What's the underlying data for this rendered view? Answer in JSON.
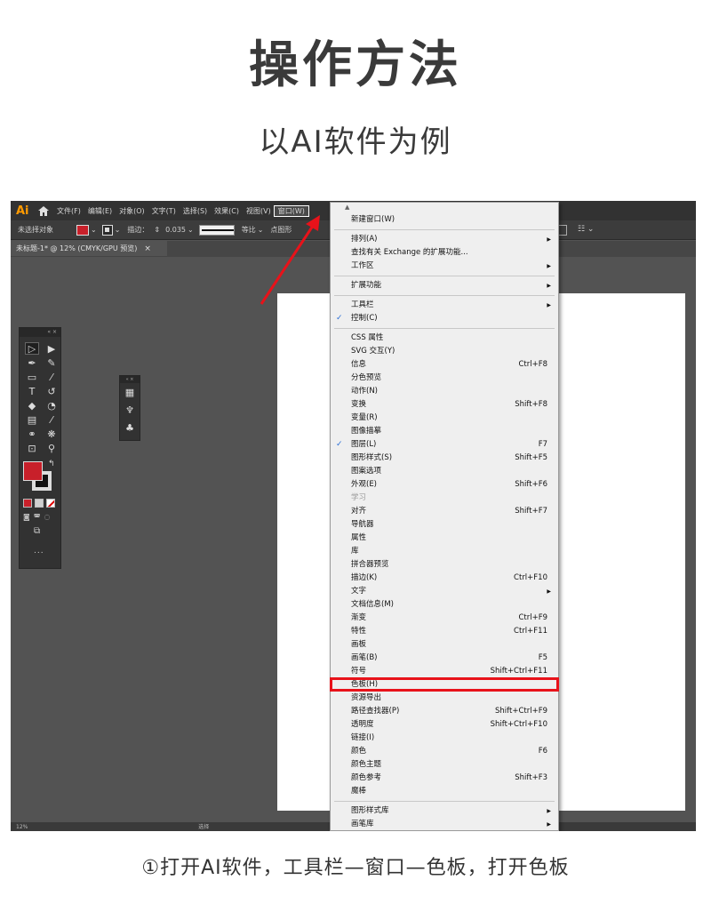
{
  "heading": "操作方法",
  "subheading": "以AI软件为例",
  "caption": "①打开AI软件，工具栏—窗口—色板，打开色板",
  "menubar": {
    "logo": "Ai",
    "items": [
      "文件(F)",
      "编辑(E)",
      "对象(O)",
      "文字(T)",
      "选择(S)",
      "效果(C)",
      "视图(V)",
      "窗口(W)"
    ]
  },
  "controlbar": {
    "selection": "未选择对象",
    "stroke_label": "描边：",
    "stroke_value": "0.035",
    "uniform": "等比",
    "brush": "点图形"
  },
  "document_tab": {
    "title": "未标题-1* @ 12% (CMYK/GPU 预览)",
    "close": "×"
  },
  "statusbar": {
    "zoom": "12%",
    "tool": "选择"
  },
  "tools_panel": {
    "more": "..."
  },
  "colors": {
    "fill": "#c8202a",
    "highlight": "#e8121a",
    "arrow": "#e8121a",
    "check": "#2b6fd6"
  },
  "window_menu": {
    "groups": [
      [
        {
          "label": "新建窗口(W)"
        }
      ],
      [
        {
          "label": "排列(A)",
          "submenu": true
        },
        {
          "label": "查找有关 Exchange 的扩展功能..."
        },
        {
          "label": "工作区",
          "submenu": true
        }
      ],
      [
        {
          "label": "扩展功能",
          "submenu": true
        }
      ],
      [
        {
          "label": "工具栏",
          "submenu": true
        },
        {
          "label": "控制(C)",
          "checked": true
        }
      ],
      [
        {
          "label": "CSS 属性"
        },
        {
          "label": "SVG 交互(Y)"
        },
        {
          "label": "信息",
          "shortcut": "Ctrl+F8"
        },
        {
          "label": "分色预览"
        },
        {
          "label": "动作(N)"
        },
        {
          "label": "变换",
          "shortcut": "Shift+F8"
        },
        {
          "label": "变量(R)"
        },
        {
          "label": "图像描摹"
        },
        {
          "label": "图层(L)",
          "shortcut": "F7",
          "checked": true
        },
        {
          "label": "图形样式(S)",
          "shortcut": "Shift+F5"
        },
        {
          "label": "图案选项"
        },
        {
          "label": "外观(E)",
          "shortcut": "Shift+F6"
        },
        {
          "label": "学习",
          "disabled": true
        },
        {
          "label": "对齐",
          "shortcut": "Shift+F7"
        },
        {
          "label": "导航器"
        },
        {
          "label": "属性"
        },
        {
          "label": "库"
        },
        {
          "label": "拼合器预览"
        },
        {
          "label": "描边(K)",
          "shortcut": "Ctrl+F10"
        },
        {
          "label": "文字",
          "submenu": true
        },
        {
          "label": "文档信息(M)"
        },
        {
          "label": "渐变",
          "shortcut": "Ctrl+F9"
        },
        {
          "label": "特性",
          "shortcut": "Ctrl+F11"
        },
        {
          "label": "画板"
        },
        {
          "label": "画笔(B)",
          "shortcut": "F5"
        },
        {
          "label": "符号",
          "shortcut": "Shift+Ctrl+F11"
        },
        {
          "label": "色板(H)",
          "highlighted": true
        },
        {
          "label": "资源导出"
        },
        {
          "label": "路径查找器(P)",
          "shortcut": "Shift+Ctrl+F9"
        },
        {
          "label": "透明度",
          "shortcut": "Shift+Ctrl+F10"
        },
        {
          "label": "链接(I)"
        },
        {
          "label": "颜色",
          "shortcut": "F6"
        },
        {
          "label": "颜色主题"
        },
        {
          "label": "颜色参考",
          "shortcut": "Shift+F3"
        },
        {
          "label": "魔棒"
        }
      ],
      [
        {
          "label": "图形样式库",
          "submenu": true
        },
        {
          "label": "画笔库",
          "submenu": true
        }
      ]
    ]
  }
}
